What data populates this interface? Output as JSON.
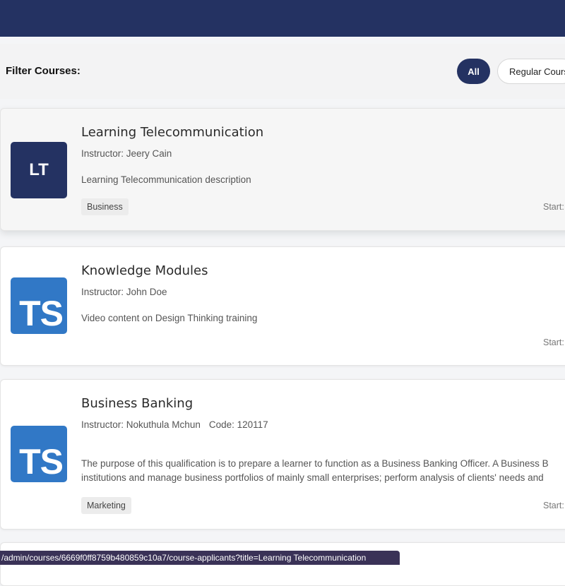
{
  "filter": {
    "label": "Filter Courses:",
    "options": [
      {
        "label": "All",
        "active": true
      },
      {
        "label": "Regular Cours",
        "active": false
      }
    ]
  },
  "courses": [
    {
      "thumb_text": "LT",
      "title": "Learning Telecommunication",
      "instructor": "Instructor: Jeery Cain",
      "code": "",
      "description": "Learning Telecommunication description",
      "tag": "Business",
      "start": "Start:"
    },
    {
      "thumb_text": "TS",
      "title": "Knowledge Modules",
      "instructor": "Instructor: John Doe",
      "code": "",
      "description": "Video content on Design Thinking training",
      "tag": "",
      "start": "Start:"
    },
    {
      "thumb_text": "TS",
      "title": "Business Banking",
      "instructor": "Instructor: Nokuthula Mchun",
      "code": "Code: 120117",
      "description_line1": "The purpose of this qualification is to prepare a learner to function as a Business Banking Officer. A Business B",
      "description_line2": "institutions and manage business portfolios of mainly small enterprises; perform analysis of clients' needs and",
      "tag": "Marketing",
      "start": "Start:"
    }
  ],
  "status_url": "/admin/courses/6669f0ff8759b480859c10a7/course-applicants?title=Learning Telecommunication",
  "colors": {
    "navy": "#243262",
    "ts_blue": "#3178c6"
  }
}
